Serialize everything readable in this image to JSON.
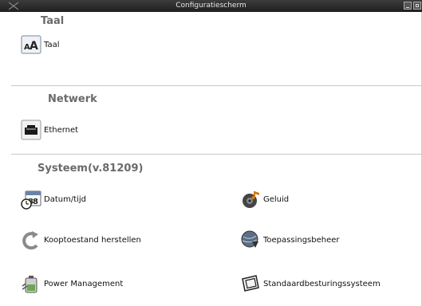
{
  "window": {
    "title": "Configuratiescherm"
  },
  "sections": {
    "taal": {
      "title": "Taal",
      "items": {
        "taal": "Taal"
      }
    },
    "netwerk": {
      "title": "Netwerk",
      "items": {
        "ethernet": "Ethernet"
      }
    },
    "systeem": {
      "title": "Systeem(v.81209)",
      "items": {
        "datum": "Datum/tijd",
        "geluid": "Geluid",
        "fabriek": "Kooptoestand herstellen",
        "toepassing": "Toepassingsbeheer",
        "power": "Power Management",
        "standaard": "Standaardbesturingssysteem"
      }
    }
  },
  "icons": {
    "taal": "text-size-icon",
    "ethernet": "ethernet-port-icon",
    "datum": "calendar-clock-icon",
    "geluid": "speaker-music-icon",
    "fabriek": "restore-arrow-icon",
    "toepassing": "globe-download-icon",
    "power": "battery-power-icon",
    "standaard": "default-os-window-icon"
  }
}
